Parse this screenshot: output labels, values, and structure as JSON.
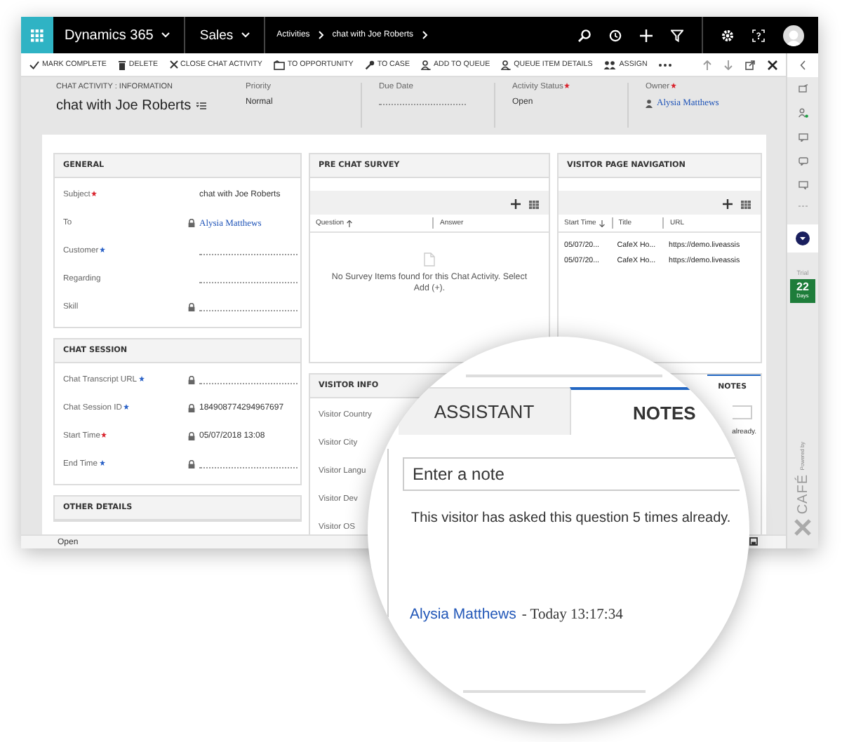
{
  "app_bar": {
    "product": "Dynamics 365",
    "area": "Sales",
    "breadcrumb": [
      "Activities",
      "chat with Joe Roberts"
    ]
  },
  "commands": [
    {
      "kind": "check",
      "label": "MARK COMPLETE"
    },
    {
      "kind": "trash",
      "label": "DELETE"
    },
    {
      "kind": "close",
      "label": "CLOSE CHAT ACTIVITY"
    },
    {
      "kind": "opportunity",
      "label": "TO OPPORTUNITY"
    },
    {
      "kind": "wrench",
      "label": "TO CASE"
    },
    {
      "kind": "queue",
      "label": "ADD TO QUEUE"
    },
    {
      "kind": "queue",
      "label": "QUEUE ITEM DETAILS"
    },
    {
      "kind": "assign",
      "label": "ASSIGN"
    }
  ],
  "header": {
    "form_name": "CHAT ACTIVITY : INFORMATION",
    "title": "chat with Joe Roberts",
    "fields": [
      {
        "label": "Priority",
        "value": "Normal"
      },
      {
        "label": "Due Date"
      },
      {
        "label": "Activity Status",
        "required": true,
        "value": "Open"
      },
      {
        "label": "Owner",
        "required": true,
        "value": "Alysia Matthews",
        "kind": "lookup"
      }
    ]
  },
  "general": {
    "title": "GENERAL",
    "rows": [
      {
        "label": "Subject",
        "required": true,
        "value": "chat with Joe Roberts"
      },
      {
        "label": "To",
        "locked": true,
        "value": "Alysia Matthews",
        "kind": "lookup"
      },
      {
        "label": "Customer",
        "recommended": true
      },
      {
        "label": "Regarding"
      },
      {
        "label": "Skill",
        "locked": true
      }
    ]
  },
  "chat_session": {
    "title": "CHAT SESSION",
    "rows": [
      {
        "label": "Chat Transcript URL",
        "recommended": true,
        "locked": true
      },
      {
        "label": "Chat Session ID",
        "recommended": true,
        "locked": true,
        "value": "184908774294967697"
      },
      {
        "label": "Start Time",
        "required": true,
        "locked": true,
        "value": "05/07/2018  13:08"
      },
      {
        "label": "End Time",
        "recommended": true,
        "locked": true
      }
    ]
  },
  "other_details": {
    "title": "OTHER DETAILS"
  },
  "pre_chat_survey": {
    "title": "PRE CHAT SURVEY",
    "columns": [
      {
        "label": "Question",
        "sorted_ascending": true
      },
      {
        "label": "Answer"
      }
    ],
    "empty_message": "No Survey Items found for this Chat Activity. Select Add (+)."
  },
  "visitor_page_navigation": {
    "title": "VISITOR PAGE NAVIGATION",
    "columns": [
      {
        "label": "Start Time",
        "sorted_descending": true
      },
      {
        "label": "Title"
      },
      {
        "label": "URL"
      }
    ],
    "rows": [
      [
        "05/07/20...",
        "CafeX Ho...",
        "https://demo.liveassis"
      ],
      [
        "05/07/20...",
        "CafeX Ho...",
        "https://demo.liveassis"
      ]
    ]
  },
  "visitor_info": {
    "title": "VISITOR INFO",
    "rows": [
      {
        "label": "Visitor Country"
      },
      {
        "label": "Visitor City"
      },
      {
        "label": "Visitor Langu"
      },
      {
        "label": "Visitor Dev"
      },
      {
        "label": "Visitor OS"
      }
    ]
  },
  "side_tabs": {
    "tabs": [
      {
        "label": "NOTES",
        "selected": true
      }
    ],
    "note_fragment": "already."
  },
  "status_bar": {
    "status": "Open"
  },
  "rail": {
    "trial_label": "Trial",
    "days": "22",
    "days_unit": "Days",
    "powered_by": "Powered by",
    "brand": "CAFÉ"
  },
  "magnifier": {
    "tabs": [
      {
        "label": "ASSISTANT",
        "selected": false
      },
      {
        "label": "NOTES",
        "selected": true
      }
    ],
    "note_input": {
      "placeholder": "Enter a note"
    },
    "note": {
      "text": "This visitor has asked this question 5 times already.",
      "author": "Alysia Matthews",
      "meta": "- Today 13:17:34"
    }
  }
}
